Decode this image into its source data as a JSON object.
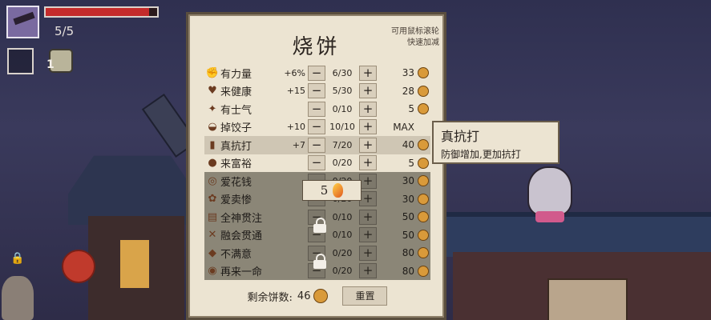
{
  "hud": {
    "health_fraction": 0.93,
    "hp_text": "5/5",
    "jar_count": "1"
  },
  "panel": {
    "title": "烧饼",
    "hint_line1": "可用鼠标滚轮",
    "hint_line2": "快速加减",
    "minus": "−",
    "plus": "+",
    "rows": [
      {
        "icon": "fist-icon",
        "name": "有力量",
        "bonus": "+6%",
        "level": "6/30",
        "price": "33"
      },
      {
        "icon": "heart-icon",
        "name": "来健康",
        "bonus": "+15",
        "level": "5/30",
        "price": "28"
      },
      {
        "icon": "cheer-icon",
        "name": "有士气",
        "bonus": "",
        "level": "0/10",
        "price": "5"
      },
      {
        "icon": "dumpling-icon",
        "name": "掉饺子",
        "bonus": "+10",
        "level": "10/10",
        "price": "MAX"
      },
      {
        "icon": "cup-icon",
        "name": "真抗打",
        "bonus": "+7",
        "level": "7/20",
        "price": "40"
      },
      {
        "icon": "gold-icon",
        "name": "来富裕",
        "bonus": "",
        "level": "0/20",
        "price": "5"
      },
      {
        "icon": "coin-stack-icon",
        "name": "爱花钱",
        "bonus": "",
        "level": "0/20",
        "price": "30"
      },
      {
        "icon": "flower-icon",
        "name": "爱卖惨",
        "bonus": "",
        "level": "0/20",
        "price": "30"
      },
      {
        "icon": "book-icon",
        "name": "全神贯注",
        "bonus": "",
        "level": "0/10",
        "price": "50"
      },
      {
        "icon": "link-icon",
        "name": "融会贯通",
        "bonus": "",
        "level": "0/10",
        "price": "50"
      },
      {
        "icon": "gem-icon",
        "name": "不满意",
        "bonus": "",
        "level": "0/20",
        "price": "80"
      },
      {
        "icon": "bowl-icon",
        "name": "再来一命",
        "bonus": "",
        "level": "0/20",
        "price": "80"
      }
    ],
    "unlock_cost": "5",
    "footer_label": "剩余饼数:",
    "footer_count": "46",
    "reset_label": "重置"
  },
  "tooltip": {
    "title": "真抗打",
    "desc": "防御增加,更加抗打"
  }
}
